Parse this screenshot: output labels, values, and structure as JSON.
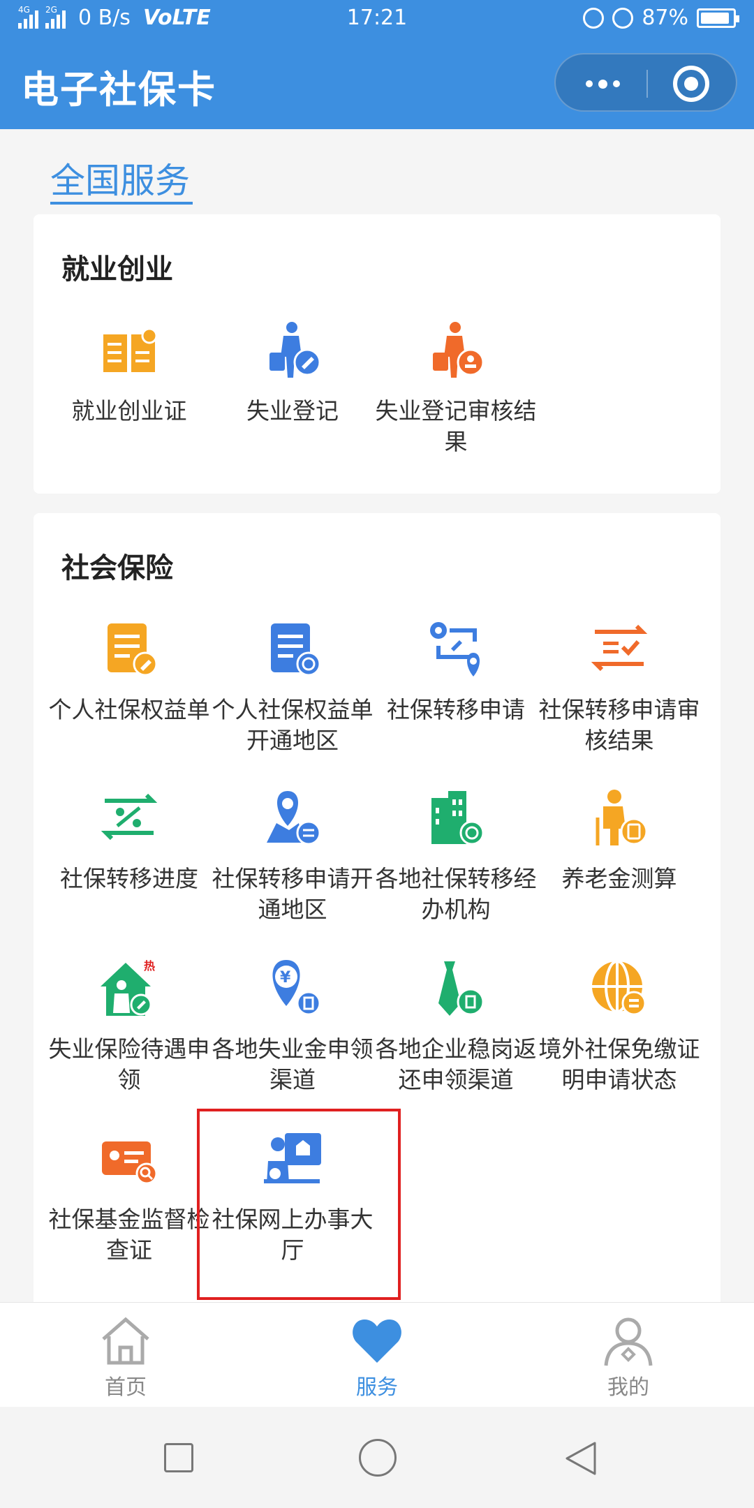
{
  "status_bar": {
    "speed": "0 B/s",
    "volte": "VoLTE",
    "time": "17:21",
    "battery": "87%",
    "battery_level": 0.87
  },
  "header": {
    "title": "电子社保卡"
  },
  "section_tab": "全国服务",
  "cards": [
    {
      "title": "就业创业",
      "items": [
        {
          "label": "就业创业证",
          "icon": "book-icon",
          "color": "#f5a623"
        },
        {
          "label": "失业登记",
          "icon": "person-luggage-icon",
          "color": "#3d7de0"
        },
        {
          "label": "失业登记审核结果",
          "icon": "person-luggage-check-icon",
          "color": "#f06a2a"
        }
      ]
    },
    {
      "title": "社会保险",
      "items": [
        {
          "label": "个人社保权益单",
          "icon": "document-edit-icon",
          "color": "#f5a623"
        },
        {
          "label": "个人社保权益单开通地区",
          "icon": "document-globe-icon",
          "color": "#3d7de0"
        },
        {
          "label": "社保转移申请",
          "icon": "transfer-location-icon",
          "color": "#3d7de0"
        },
        {
          "label": "社保转移申请审核结果",
          "icon": "transfer-check-icon",
          "color": "#f06a2a"
        },
        {
          "label": "社保转移进度",
          "icon": "transfer-percent-icon",
          "color": "#1fae6e"
        },
        {
          "label": "社保转移申请开通地区",
          "icon": "map-pin-transfer-icon",
          "color": "#3d7de0"
        },
        {
          "label": "各地社保转移经办机构",
          "icon": "building-globe-icon",
          "color": "#1fae6e"
        },
        {
          "label": "养老金测算",
          "icon": "elder-calculator-icon",
          "color": "#f5a623"
        },
        {
          "label": "失业保险待遇申领",
          "icon": "house-person-hot-icon",
          "color": "#1fae6e"
        },
        {
          "label": "各地失业金申领渠道",
          "icon": "yuan-pin-icon",
          "color": "#3d7de0"
        },
        {
          "label": "各地企业稳岗返还申领渠道",
          "icon": "tie-coin-icon",
          "color": "#1fae6e"
        },
        {
          "label": "境外社保免缴证明申请状态",
          "icon": "globe-document-icon",
          "color": "#f5a623"
        },
        {
          "label": "社保基金监督检查证",
          "icon": "card-search-icon",
          "color": "#f06a2a"
        },
        {
          "label": "社保网上办事大厅",
          "icon": "person-screen-icon",
          "color": "#3d7de0"
        }
      ]
    }
  ],
  "tabs": [
    {
      "label": "首页",
      "icon": "home-icon"
    },
    {
      "label": "服务",
      "icon": "heart-icon"
    },
    {
      "label": "我的",
      "icon": "user-icon"
    }
  ],
  "colors": {
    "brand": "#3d8fe0",
    "highlight": "#e02020"
  }
}
